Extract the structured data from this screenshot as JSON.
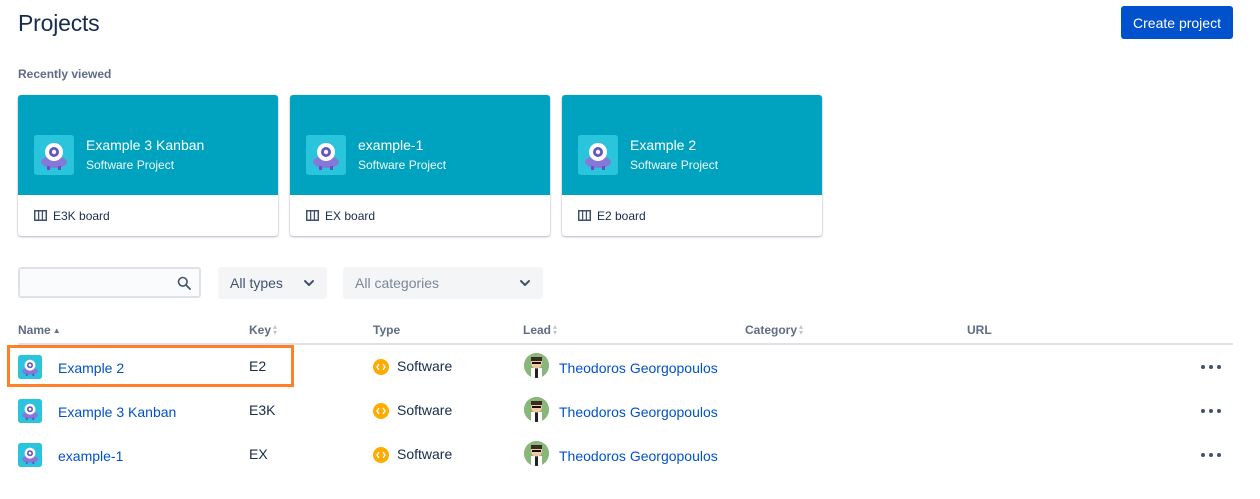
{
  "header": {
    "title": "Projects",
    "create_label": "Create project"
  },
  "recent": {
    "label": "Recently viewed",
    "cards": [
      {
        "name": "Example 3 Kanban",
        "type": "Software Project",
        "board": "E3K board"
      },
      {
        "name": "example-1",
        "type": "Software Project",
        "board": "EX board"
      },
      {
        "name": "Example 2",
        "type": "Software Project",
        "board": "E2 board"
      }
    ]
  },
  "filters": {
    "search_placeholder": "",
    "types_label": "All types",
    "categories_label": "All categories"
  },
  "table": {
    "columns": [
      "Name",
      "Key",
      "Type",
      "Lead",
      "Category",
      "URL"
    ],
    "rows": [
      {
        "name": "Example 2",
        "key": "E2",
        "type": "Software",
        "lead": "Theodoros Georgopoulos"
      },
      {
        "name": "Example 3 Kanban",
        "key": "E3K",
        "type": "Software",
        "lead": "Theodoros Georgopoulos"
      },
      {
        "name": "example-1",
        "key": "EX",
        "type": "Software",
        "lead": "Theodoros Georgopoulos"
      }
    ]
  },
  "colors": {
    "brand": "#0052cc",
    "card_header": "#00a3bf",
    "highlight": "#ff7f2a",
    "software_badge": "#ffab00"
  },
  "icons": [
    "search-icon",
    "chevron-down-icon",
    "board-icon",
    "software-type-icon",
    "more-icon",
    "project-avatar-icon",
    "user-avatar-icon"
  ]
}
